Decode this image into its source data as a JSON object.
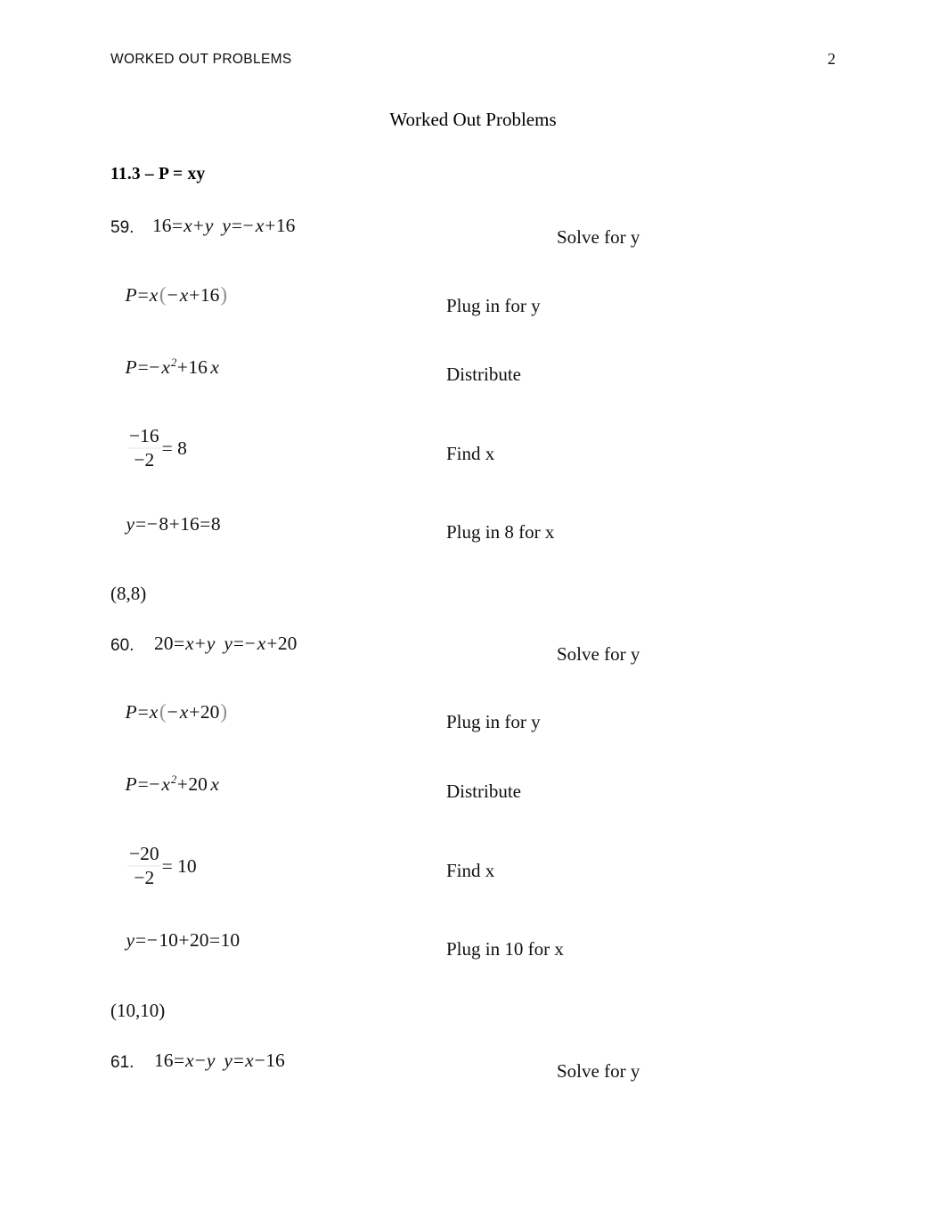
{
  "header": {
    "running_title": "WORKED OUT PROBLEMS",
    "page_number": "2"
  },
  "document": {
    "title": "Worked Out Problems",
    "section_heading": "11.3 – P = xy"
  },
  "problems": [
    {
      "number": "59.",
      "answer": "(8,8)",
      "lines": [
        {
          "kind": "inline",
          "math_text": "16 = x + y   y = − x + 16",
          "instruction": "Solve for y"
        },
        {
          "kind": "inline",
          "math_text": "P = x ( − x + 16 )",
          "instruction": "Plug in for y"
        },
        {
          "kind": "inline",
          "math_text": "P = − x² + 16 x",
          "instruction": "Distribute"
        },
        {
          "kind": "fraction",
          "numerator": "−16",
          "denominator": "−2",
          "result": "= 8",
          "instruction": "Find x"
        },
        {
          "kind": "inline",
          "math_text": "y = − 8 + 16 = 8",
          "instruction": "Plug in 8 for x"
        }
      ]
    },
    {
      "number": "60.",
      "answer": "(10,10)",
      "lines": [
        {
          "kind": "inline",
          "math_text": "20 = x + y   y = − x + 20",
          "instruction": "Solve for y"
        },
        {
          "kind": "inline",
          "math_text": "P = x ( − x + 20 )",
          "instruction": "Plug in for y"
        },
        {
          "kind": "inline",
          "math_text": "P = − x² + 20 x",
          "instruction": "Distribute"
        },
        {
          "kind": "fraction",
          "numerator": "−20",
          "denominator": "−2",
          "result": "= 10",
          "instruction": "Find x"
        },
        {
          "kind": "inline",
          "math_text": "y = − 10 + 20 = 10",
          "instruction": "Plug in 10 for x"
        }
      ]
    },
    {
      "number": "61.",
      "answer": "",
      "lines": [
        {
          "kind": "inline",
          "math_text": "16 = x − y   y = x − 16",
          "instruction": "Solve for y"
        }
      ]
    }
  ],
  "tokens": {
    "p59": {
      "l1": {
        "a": "16",
        "eq": "=",
        "x": "x",
        "plus": "+",
        "y": "y",
        "y2": "y",
        "eq2": "=",
        "neg": "−",
        "x2": "x",
        "plus2": "+",
        "c": "16"
      },
      "l2": {
        "P": "P",
        "eq": "=",
        "x": "x",
        "lp": "(",
        "neg": "−",
        "x2": "x",
        "plus": "+",
        "c": "16",
        "rp": ")"
      },
      "l3": {
        "P": "P",
        "eq": "=",
        "neg": "−",
        "x": "x",
        "sup": "2",
        "plus": "+",
        "c": "16",
        "x2": "x"
      },
      "l5": {
        "y": "y",
        "eq": "=",
        "neg": "−",
        "a": "8",
        "plus": "+",
        "b": "16",
        "eq2": "=",
        "c": "8"
      }
    },
    "p60": {
      "l1": {
        "a": "20",
        "eq": "=",
        "x": "x",
        "plus": "+",
        "y": "y",
        "y2": "y",
        "eq2": "=",
        "neg": "−",
        "x2": "x",
        "plus2": "+",
        "c": "20"
      },
      "l2": {
        "P": "P",
        "eq": "=",
        "x": "x",
        "lp": "(",
        "neg": "−",
        "x2": "x",
        "plus": "+",
        "c": "20",
        "rp": ")"
      },
      "l3": {
        "P": "P",
        "eq": "=",
        "neg": "−",
        "x": "x",
        "sup": "2",
        "plus": "+",
        "c": "20",
        "x2": "x"
      },
      "l5": {
        "y": "y",
        "eq": "=",
        "neg": "−",
        "a": "10",
        "plus": "+",
        "b": "20",
        "eq2": "=",
        "c": "10"
      }
    },
    "p61": {
      "l1": {
        "a": "16",
        "eq": "=",
        "x": "x",
        "minus": "−",
        "y": "y",
        "y2": "y",
        "eq2": "=",
        "x2": "x",
        "minus2": "−",
        "c": "16"
      }
    }
  }
}
